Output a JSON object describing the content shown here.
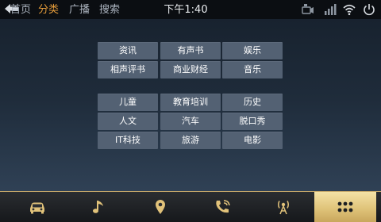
{
  "header": {
    "tabs": [
      {
        "label": "首页",
        "active": false
      },
      {
        "label": "分类",
        "active": true
      },
      {
        "label": "广播",
        "active": false
      },
      {
        "label": "搜索",
        "active": false
      }
    ],
    "time": "下午1:40",
    "status_icons": [
      "dvr-camera-icon",
      "signal-icon",
      "wifi-icon",
      "power-icon"
    ]
  },
  "categories": [
    [
      "资讯",
      "有声书",
      "娱乐"
    ],
    [
      "相声评书",
      "商业财经",
      "音乐"
    ],
    [
      "儿童",
      "教育培训",
      "历史"
    ],
    [
      "人文",
      "汽车",
      "脱口秀"
    ],
    [
      "IT科技",
      "旅游",
      "电影"
    ]
  ],
  "dock": {
    "items": [
      "car-icon",
      "music-note-icon",
      "location-pin-icon",
      "phone-icon",
      "radio-tower-icon",
      "apps-grid-icon"
    ],
    "active_index": 5
  },
  "colors": {
    "accent": "#e39b3a",
    "button_bg": "#536173",
    "dock_active": "#e0c47a"
  }
}
